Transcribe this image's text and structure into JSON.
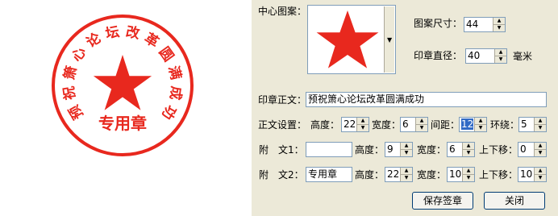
{
  "seal": {
    "ring_text": "预祝箫心论坛改革圆满成功",
    "bottom_text": "专用章",
    "color": "#e8281e"
  },
  "pattern": {
    "label": "中心图案：",
    "icon": "red-star-icon",
    "color": "#e8281e"
  },
  "pattern_size": {
    "label": "图案尺寸：",
    "value": "44"
  },
  "seal_diameter": {
    "label": "印章直径：",
    "value": "40",
    "unit": "毫米"
  },
  "main_text": {
    "label": "印章正文：",
    "value": "预祝箫心论坛改革圆满成功"
  },
  "text_settings": {
    "label": "正文设置：",
    "height_label": "高度：",
    "height": "22",
    "width_label": "宽度：",
    "width": "6",
    "spacing_label": "间距：",
    "spacing": "12",
    "ring_label": "环绕：",
    "ring": "5"
  },
  "sub1": {
    "label_a": "附",
    "label_b": "文1：",
    "value": "",
    "height_label": "高度：",
    "height": "9",
    "width_label": "宽度：",
    "width": "6",
    "shift_label": "上下移：",
    "shift": "0"
  },
  "sub2": {
    "label_a": "附",
    "label_b": "文2：",
    "value": "专用章",
    "height_label": "高度：",
    "height": "22",
    "width_label": "宽度：",
    "width": "10",
    "shift_label": "上下移：",
    "shift": "10"
  },
  "buttons": {
    "save": "保存签章",
    "close": "关闭"
  }
}
